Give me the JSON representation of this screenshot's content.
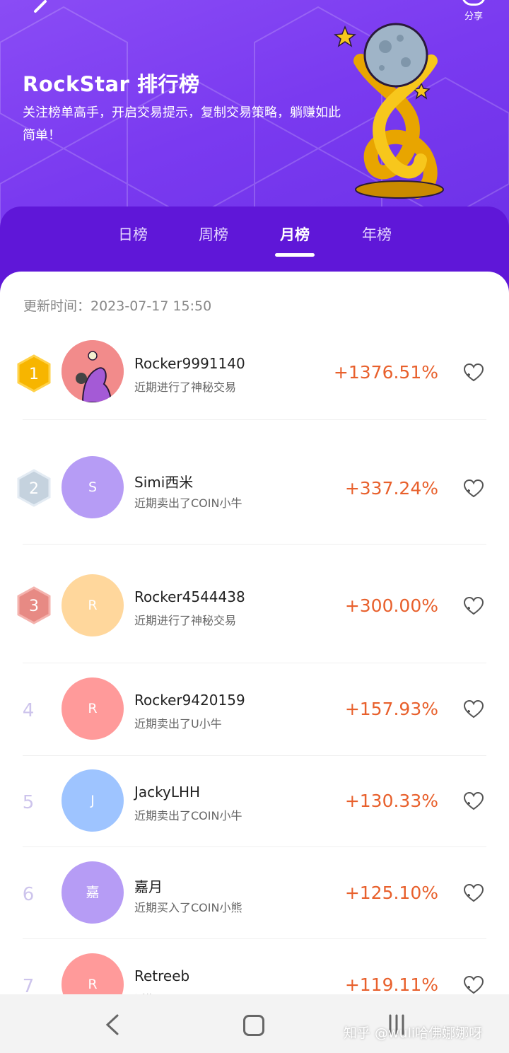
{
  "header": {
    "title": "RockStar 排行榜",
    "subtitle": "关注榜单高手，开启交易提示，复制交易策略，躺赚如此简单！",
    "share_label": "分享"
  },
  "tabs": [
    {
      "label": "日榜",
      "active": false
    },
    {
      "label": "周榜",
      "active": false
    },
    {
      "label": "月榜",
      "active": true
    },
    {
      "label": "年榜",
      "active": false
    }
  ],
  "update_time": "更新时间：2023-07-17 15:50",
  "rankings": [
    {
      "rank": "1",
      "name": "Rocker9991140",
      "activity": "近期进行了神秘交易",
      "pct": "+1376.51%",
      "avatar_text": "",
      "avatar_color": "#f28b8b"
    },
    {
      "rank": "2",
      "name": "Simi西米",
      "activity": "近期卖出了COIN小牛",
      "pct": "+337.24%",
      "avatar_text": "S",
      "avatar_color": "#b69cf5"
    },
    {
      "rank": "3",
      "name": "Rocker4544438",
      "activity": "近期进行了神秘交易",
      "pct": "+300.00%",
      "avatar_text": "R",
      "avatar_color": "#ffd79c"
    },
    {
      "rank": "4",
      "name": "Rocker9420159",
      "activity": "近期卖出了U小牛",
      "pct": "+157.93%",
      "avatar_text": "R",
      "avatar_color": "#ff9a9a"
    },
    {
      "rank": "5",
      "name": "JackyLHH",
      "activity": "近期卖出了COIN小牛",
      "pct": "+130.33%",
      "avatar_text": "J",
      "avatar_color": "#9ec4ff"
    },
    {
      "rank": "6",
      "name": "嘉月",
      "activity": "近期买入了COIN小熊",
      "pct": "+125.10%",
      "avatar_text": "嘉",
      "avatar_color": "#b69cf5"
    },
    {
      "rank": "7",
      "name": "Retreeb",
      "activity": "近期买入了FROB",
      "pct": "+119.11%",
      "avatar_text": "R",
      "avatar_color": "#ff9a9a"
    }
  ],
  "watermark": "知乎 @wuli哈佛娜娜呀",
  "colors": {
    "header_purple": "#7a3af0",
    "tab_bar": "#5f17d8",
    "pct_orange": "#e8602c",
    "gold": "#f7b500"
  },
  "icons": {
    "back": "chevron-left-icon",
    "share": "share-icon",
    "follow": "heart-plus-icon"
  }
}
